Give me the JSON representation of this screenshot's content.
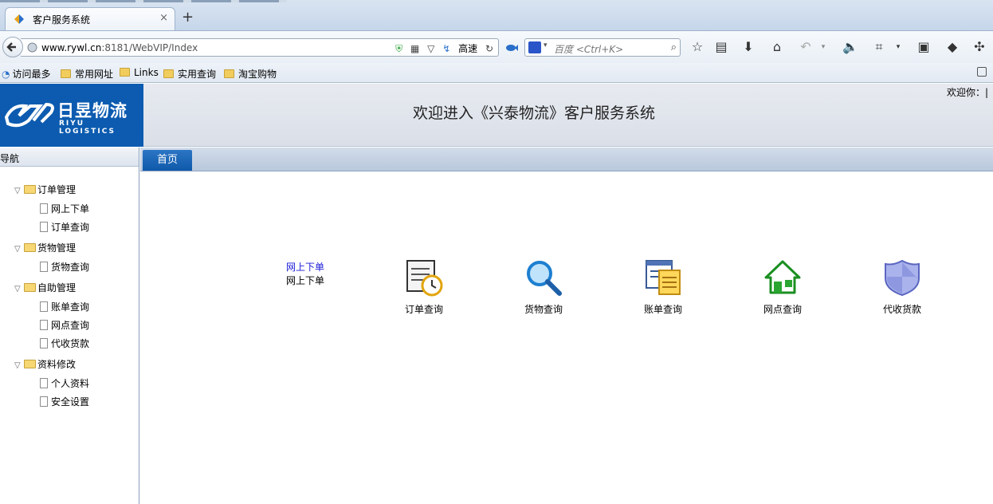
{
  "browser": {
    "tab_title": "客户服务系统",
    "tab_close": "×",
    "new_tab": "+",
    "url_host": "www.rywl.cn",
    "url_rest": ":8181/WebVIP/Index",
    "speed_label": "高速",
    "search_placeholder": "百度 <Ctrl+K>",
    "bookmarks": [
      "访问最多",
      "常用网址",
      "Links",
      "实用查询",
      "淘宝购物"
    ]
  },
  "header": {
    "logo_name": "日昱物流",
    "logo_sub": "RIYU LOGISTICS",
    "title": "欢迎进入《兴泰物流》客户服务系统",
    "welcome": "欢迎你：|"
  },
  "nav": {
    "title": "导航",
    "groups": [
      {
        "label": "订单管理",
        "items": [
          "网上下单",
          "订单查询"
        ]
      },
      {
        "label": "货物管理",
        "items": [
          "货物查询"
        ]
      },
      {
        "label": "自助管理",
        "items": [
          "账单查询",
          "网点查询",
          "代收货款"
        ]
      },
      {
        "label": "资料修改",
        "items": [
          "个人资料",
          "安全设置"
        ]
      }
    ]
  },
  "main": {
    "tab_home": "首页",
    "quick_link": "网上下单",
    "quick_text": "网上下单",
    "quick_icons": [
      {
        "label": "订单查询",
        "icon": "order-clock-icon"
      },
      {
        "label": "货物查询",
        "icon": "magnifier-icon"
      },
      {
        "label": "账单查询",
        "icon": "bill-documents-icon"
      },
      {
        "label": "网点查询",
        "icon": "house-icon"
      },
      {
        "label": "代收货款",
        "icon": "shield-icon"
      }
    ]
  },
  "colors": {
    "logo_bg": "#0c5bb0",
    "tab_active": "#1560b0",
    "link": "#1a1ad8"
  }
}
